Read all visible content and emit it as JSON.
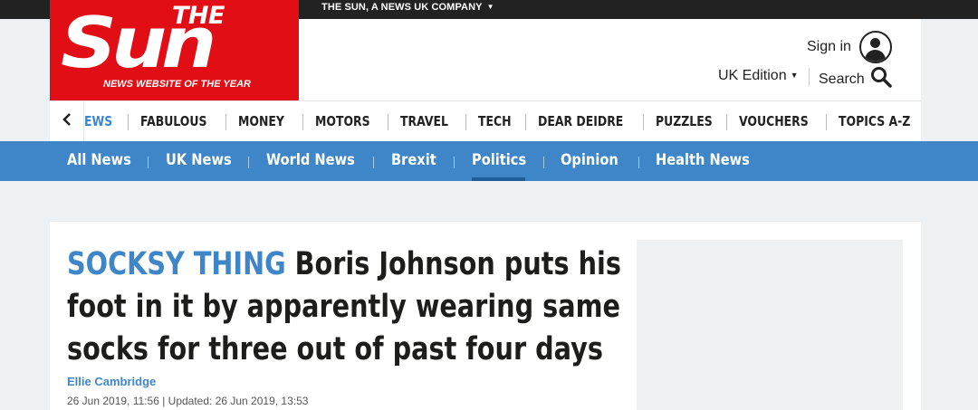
{
  "top_bar": {
    "company_label": "THE SUN, A NEWS UK COMPANY"
  },
  "logo": {
    "the": "THE",
    "sun": "Sun",
    "tagline": "NEWS WEBSITE OF THE YEAR",
    "bg_color": "#e20e16"
  },
  "account": {
    "sign_in_label": "Sign in",
    "avatar_icon": "user-avatar-icon"
  },
  "edition": {
    "label": "UK Edition"
  },
  "search": {
    "label": "Search",
    "icon": "search-icon"
  },
  "main_nav": {
    "prev_icon": "chevron-left-icon",
    "items": [
      {
        "label": "EWS",
        "partial": true
      },
      {
        "label": "FABULOUS"
      },
      {
        "label": "MONEY"
      },
      {
        "label": "MOTORS"
      },
      {
        "label": "TRAVEL"
      },
      {
        "label": "TECH"
      },
      {
        "label": "DEAR DEIDRE"
      },
      {
        "label": "PUZZLES"
      },
      {
        "label": "VOUCHERS"
      },
      {
        "label": "TOPICS A-Z"
      }
    ]
  },
  "sub_nav": {
    "bg_color": "#3f86c9",
    "active": "Politics",
    "items": [
      {
        "label": "All News"
      },
      {
        "label": "UK News"
      },
      {
        "label": "World News"
      },
      {
        "label": "Brexit"
      },
      {
        "label": "Politics"
      },
      {
        "label": "Opinion"
      },
      {
        "label": "Health News"
      }
    ]
  },
  "article": {
    "kicker": "SOCKSY THING",
    "headline": "Boris Johnson puts his foot in it by apparently wearing same socks for three out of past four days",
    "author": "Ellie Cambridge",
    "dates": "26 Jun 2019, 11:56 | Updated: 26 Jun 2019, 13:53"
  }
}
